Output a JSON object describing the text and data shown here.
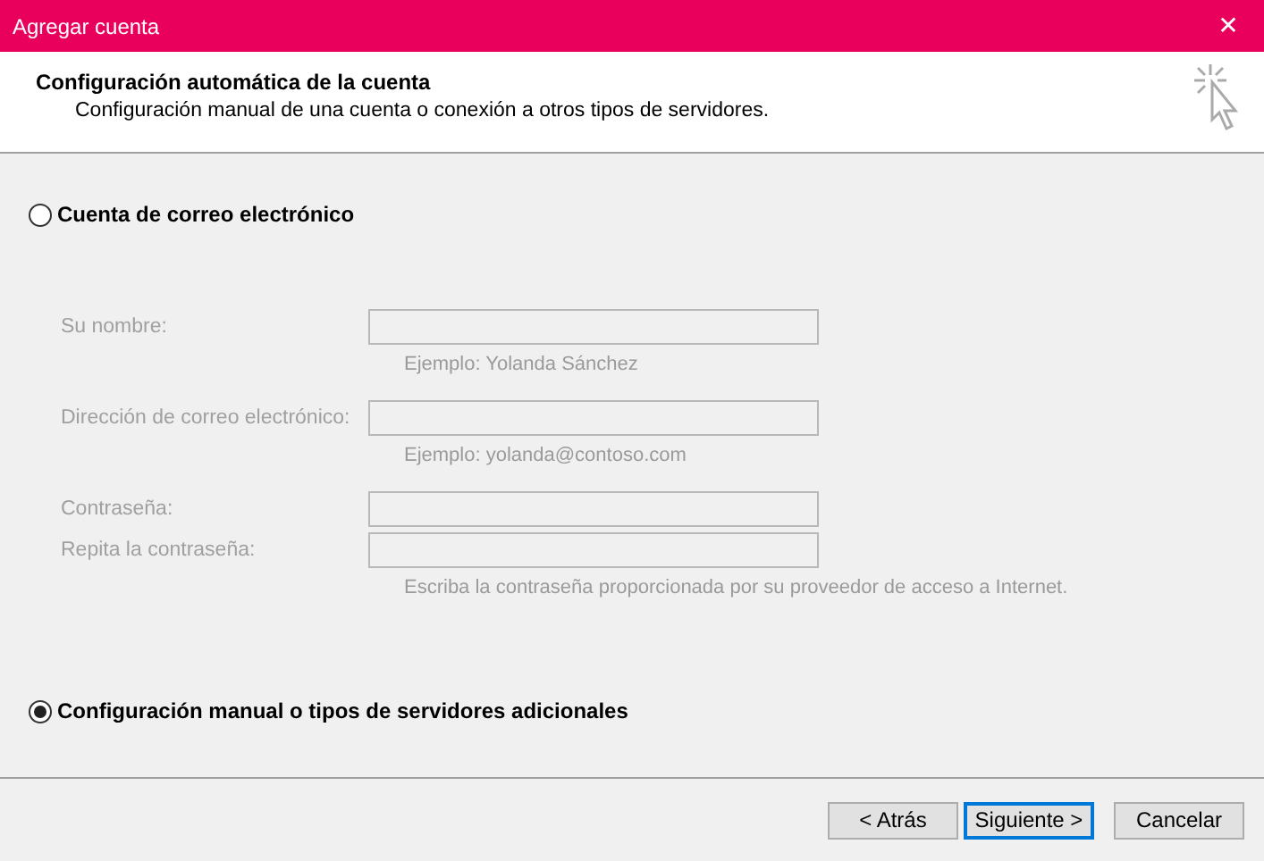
{
  "window": {
    "title": "Agregar cuenta",
    "close": "✕"
  },
  "header": {
    "title": "Configuración automática de la cuenta",
    "subtitle": "Configuración manual de una cuenta o conexión a otros tipos de servidores."
  },
  "options": [
    {
      "label": "Cuenta de correo electrónico",
      "selected": false
    },
    {
      "label": "Configuración manual o tipos de servidores adicionales",
      "selected": true
    }
  ],
  "fields": [
    {
      "label": "Su nombre:",
      "hint": "Ejemplo: Yolanda Sánchez",
      "disabled": true
    },
    {
      "label": "Dirección de correo electrónico:",
      "hint": "Ejemplo: yolanda@contoso.com",
      "disabled": true
    },
    {
      "label": "Contraseña:",
      "disabled": true
    },
    {
      "label": "Repita la contraseña:",
      "hint": "Escriba la contraseña proporcionada por su proveedor de acceso a Internet.",
      "disabled": true
    }
  ],
  "buttons": [
    {
      "label": "< Atrás",
      "default": false
    },
    {
      "label": "Siguiente >",
      "default": true
    },
    {
      "label": "Cancelar",
      "default": false
    }
  ]
}
